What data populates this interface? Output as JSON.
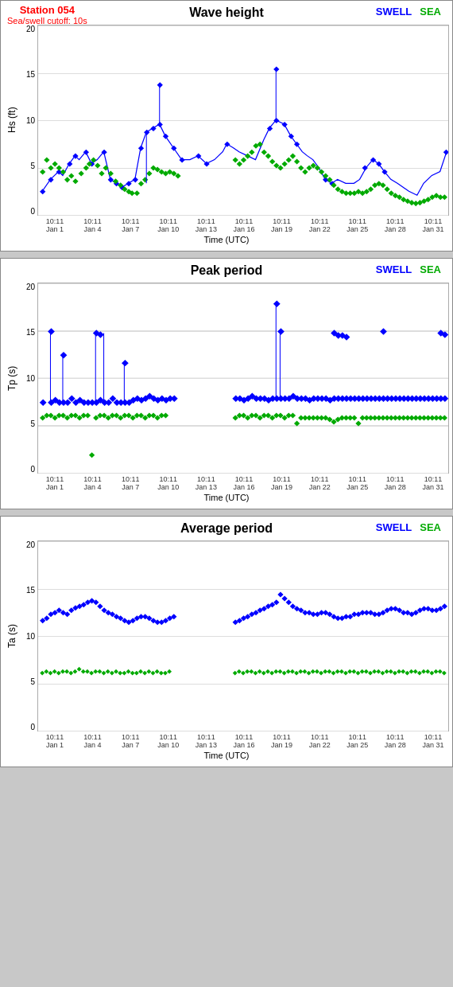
{
  "station": {
    "name": "Station 054",
    "cutoff": "Sea/swell cutoff: 10s"
  },
  "legend": {
    "swell": "SWELL",
    "sea": "SEA"
  },
  "charts": [
    {
      "title": "Wave height",
      "y_label": "Hs (ft)",
      "y_max": 20,
      "y_ticks": [
        "20",
        "15",
        "10",
        "5",
        "0"
      ],
      "x_ticks": [
        {
          "time": "10:11",
          "date": "Jan 1"
        },
        {
          "time": "10:11",
          "date": "Jan 4"
        },
        {
          "time": "10:11",
          "date": "Jan 7"
        },
        {
          "time": "10:11",
          "date": "Jan 10"
        },
        {
          "time": "10:11",
          "date": "Jan 13"
        },
        {
          "time": "10:11",
          "date": "Jan 16"
        },
        {
          "time": "10:11",
          "date": "Jan 19"
        },
        {
          "time": "10:11",
          "date": "Jan 22"
        },
        {
          "time": "10:11",
          "date": "Jan 25"
        },
        {
          "time": "10:11",
          "date": "Jan 28"
        },
        {
          "time": "10:11",
          "date": "Jan 31"
        }
      ],
      "x_axis_title": "Time (UTC)"
    },
    {
      "title": "Peak period",
      "y_label": "Tp (s)",
      "y_max": 20,
      "y_ticks": [
        "20",
        "15",
        "10",
        "5",
        "0"
      ],
      "x_ticks": [
        {
          "time": "10:11",
          "date": "Jan 1"
        },
        {
          "time": "10:11",
          "date": "Jan 4"
        },
        {
          "time": "10:11",
          "date": "Jan 7"
        },
        {
          "time": "10:11",
          "date": "Jan 10"
        },
        {
          "time": "10:11",
          "date": "Jan 13"
        },
        {
          "time": "10:11",
          "date": "Jan 16"
        },
        {
          "time": "10:11",
          "date": "Jan 19"
        },
        {
          "time": "10:11",
          "date": "Jan 22"
        },
        {
          "time": "10:11",
          "date": "Jan 25"
        },
        {
          "time": "10:11",
          "date": "Jan 28"
        },
        {
          "time": "10:11",
          "date": "Jan 31"
        }
      ],
      "x_axis_title": "Time (UTC)"
    },
    {
      "title": "Average period",
      "y_label": "Ta (s)",
      "y_max": 20,
      "y_ticks": [
        "20",
        "15",
        "10",
        "5",
        "0"
      ],
      "x_ticks": [
        {
          "time": "10:11",
          "date": "Jan 1"
        },
        {
          "time": "10:11",
          "date": "Jan 4"
        },
        {
          "time": "10:11",
          "date": "Jan 7"
        },
        {
          "time": "10:11",
          "date": "Jan 10"
        },
        {
          "time": "10:11",
          "date": "Jan 13"
        },
        {
          "time": "10:11",
          "date": "Jan 16"
        },
        {
          "time": "10:11",
          "date": "Jan 19"
        },
        {
          "time": "10:11",
          "date": "Jan 22"
        },
        {
          "time": "10:11",
          "date": "Jan 25"
        },
        {
          "time": "10:11",
          "date": "Jan 28"
        },
        {
          "time": "10:11",
          "date": "Jan 31"
        }
      ],
      "x_axis_title": "Time (UTC)"
    }
  ]
}
